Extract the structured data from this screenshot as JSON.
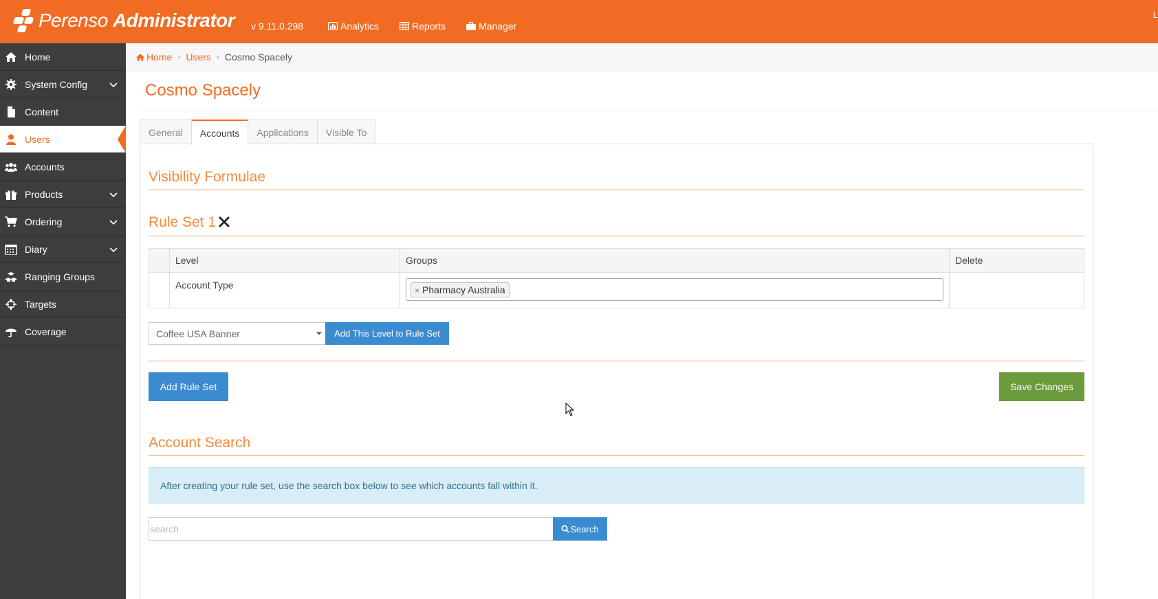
{
  "header": {
    "brand_light": "Perenso",
    "brand_bold": "Administrator",
    "version": "v 9.11.0.298",
    "nav": [
      {
        "label": "Analytics",
        "icon": "bar-chart-icon"
      },
      {
        "label": "Reports",
        "icon": "table-icon"
      },
      {
        "label": "Manager",
        "icon": "briefcase-icon"
      }
    ],
    "right_text": "L"
  },
  "sidebar": {
    "items": [
      {
        "label": "Home",
        "icon": "home-icon",
        "has_children": false,
        "active": false
      },
      {
        "label": "System Config",
        "icon": "gear-icon",
        "has_children": true,
        "active": false
      },
      {
        "label": "Content",
        "icon": "file-icon",
        "has_children": false,
        "active": false
      },
      {
        "label": "Users",
        "icon": "user-icon",
        "has_children": false,
        "active": true
      },
      {
        "label": "Accounts",
        "icon": "users-group-icon",
        "has_children": false,
        "active": false
      },
      {
        "label": "Products",
        "icon": "gift-icon",
        "has_children": true,
        "active": false
      },
      {
        "label": "Ordering",
        "icon": "cart-icon",
        "has_children": true,
        "active": false
      },
      {
        "label": "Diary",
        "icon": "calendar-icon",
        "has_children": true,
        "active": false
      },
      {
        "label": "Ranging Groups",
        "icon": "cubes-icon",
        "has_children": false,
        "active": false
      },
      {
        "label": "Targets",
        "icon": "crosshairs-icon",
        "has_children": false,
        "active": false
      },
      {
        "label": "Coverage",
        "icon": "umbrella-icon",
        "has_children": false,
        "active": false
      }
    ]
  },
  "breadcrumb": {
    "home": "Home",
    "users": "Users",
    "current": "Cosmo Spacely"
  },
  "page": {
    "title": "Cosmo Spacely",
    "tabs": [
      {
        "label": "General",
        "active": false
      },
      {
        "label": "Accounts",
        "active": true
      },
      {
        "label": "Applications",
        "active": false
      },
      {
        "label": "Visible To",
        "active": false
      }
    ]
  },
  "visibility": {
    "heading": "Visibility Formulae",
    "rule_set_title": "Rule Set 1",
    "table": {
      "headers": [
        "",
        "Level",
        "Groups",
        "Delete"
      ],
      "rows": [
        {
          "level": "Account Type",
          "groups": [
            "Pharmacy Australia"
          ]
        }
      ]
    },
    "level_select_value": "Coffee USA Banner",
    "add_level_label": "Add This Level to Rule Set",
    "add_rule_set_label": "Add Rule Set",
    "save_label": "Save Changes"
  },
  "account_search": {
    "heading": "Account Search",
    "info": "After creating your rule set, use the search box below to see which accounts fall within it.",
    "placeholder": "search",
    "button_label": "Search"
  },
  "colors": {
    "brand": "#f26b22",
    "sidebar_bg": "#3d3d3d",
    "primary_button": "#3b8bd1",
    "success_button": "#6b9b3a",
    "info_bg": "#d9edf7"
  }
}
